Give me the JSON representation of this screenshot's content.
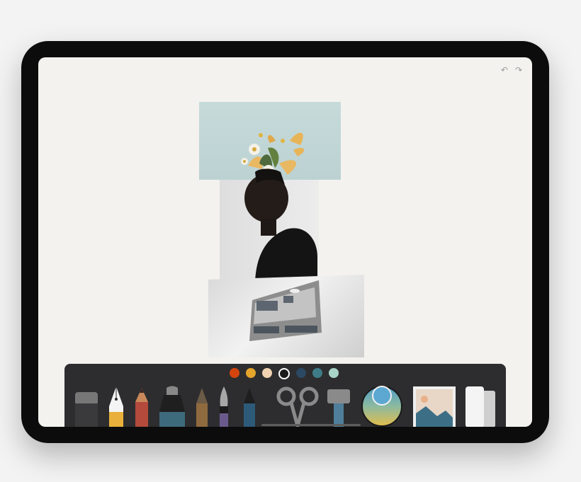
{
  "toolbar": {
    "colors": [
      "#d3450c",
      "#e5a52b",
      "#f1d3b2",
      "#1b1b1b",
      "#2c4862",
      "#3e7d87",
      "#a8d5c7"
    ],
    "active_color_index": 3
  },
  "icons": {
    "undo": "undo-icon",
    "redo": "redo-icon",
    "eraser": "eraser-icon",
    "fountain_pen": "fountain-pen-icon",
    "pencil": "pencil-icon",
    "marker": "marker-icon",
    "fine_pen": "fine-pen-icon",
    "brush": "brush-icon",
    "ink_pen": "ink-pen-icon",
    "scissors": "scissors-icon",
    "fill": "fill-bucket-icon",
    "color_picker": "color-wheel-icon",
    "image": "image-icon",
    "layers": "layers-icon"
  },
  "top": {
    "undo_glyph": "↶",
    "redo_glyph": "↷"
  }
}
